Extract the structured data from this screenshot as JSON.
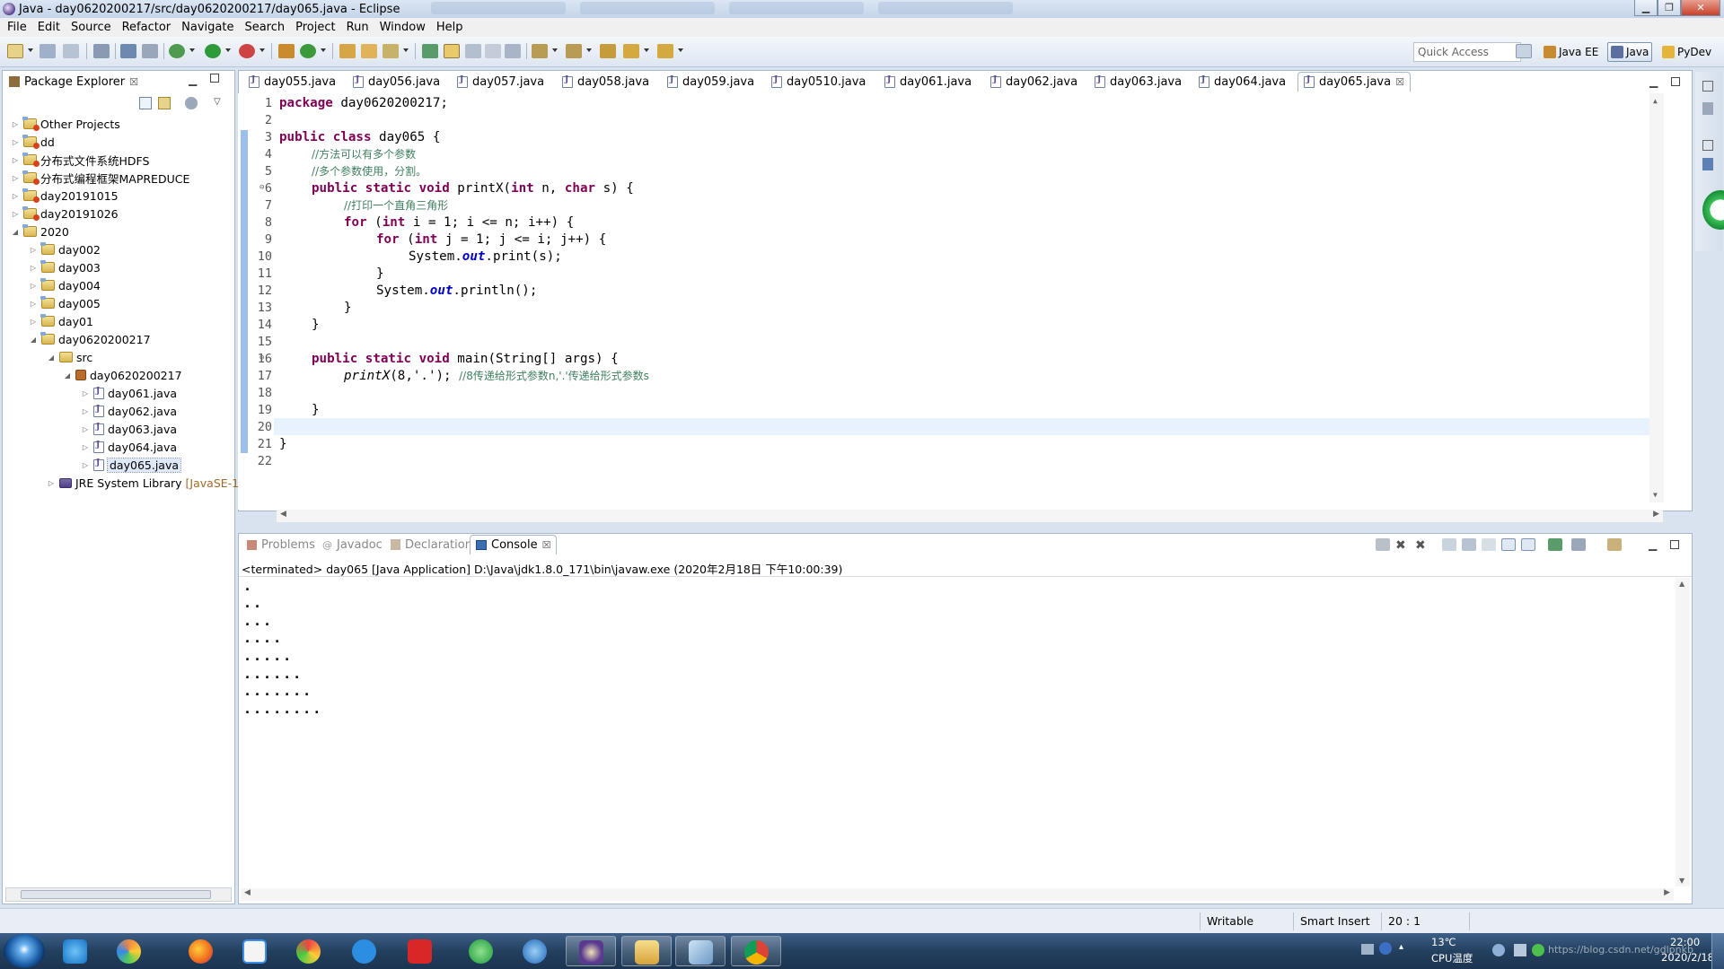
{
  "window": {
    "title": "Java - day0620200217/src/day0620200217/day065.java - Eclipse"
  },
  "menu": [
    "File",
    "Edit",
    "Source",
    "Refactor",
    "Navigate",
    "Search",
    "Project",
    "Run",
    "Window",
    "Help"
  ],
  "toolbar": {
    "quick_access": "Quick Access",
    "perspectives": [
      "Java EE",
      "Java",
      "PyDev"
    ]
  },
  "package_explorer": {
    "title": "Package Explorer",
    "tree": [
      {
        "label": "Other Projects"
      },
      {
        "label": "dd"
      },
      {
        "label": "分布式文件系统HDFS"
      },
      {
        "label": "分布式编程框架MAPREDUCE"
      },
      {
        "label": "day20191015"
      },
      {
        "label": "day20191026"
      },
      {
        "label": "2020"
      },
      {
        "label": "day002"
      },
      {
        "label": "day003"
      },
      {
        "label": "day004"
      },
      {
        "label": "day005"
      },
      {
        "label": "day01"
      },
      {
        "label": "day0620200217"
      },
      {
        "label": "src"
      },
      {
        "label": "day0620200217"
      },
      {
        "label": "day061.java"
      },
      {
        "label": "day062.java"
      },
      {
        "label": "day063.java"
      },
      {
        "label": "day064.java"
      },
      {
        "label": "day065.java"
      },
      {
        "label": "JRE System Library",
        "extra": "[JavaSE-1."
      }
    ]
  },
  "editor": {
    "tabs": [
      "day055.java",
      "day056.java",
      "day057.java",
      "day058.java",
      "day059.java",
      "day0510.java",
      "day061.java",
      "day062.java",
      "day063.java",
      "day064.java",
      "day065.java"
    ],
    "active_tab": "day065.java",
    "line_numbers": [
      "1",
      "2",
      "3",
      "4",
      "5",
      "6",
      "7",
      "8",
      "9",
      "10",
      "11",
      "12",
      "13",
      "14",
      "15",
      "16",
      "17",
      "18",
      "19",
      "20",
      "21",
      "22"
    ],
    "code": {
      "l1_kw": "package",
      "l1_rest": " day0620200217;",
      "l3_kw": "public class",
      "l3_rest": " day065 {",
      "l4": "//方法可以有多个参数",
      "l5": "//多个参数使用，分割。",
      "l6_kw": "public static void",
      "l6_a": " printX(",
      "l6_kw2": "int",
      "l6_b": " n, ",
      "l6_kw3": "char",
      "l6_c": " s) {",
      "l7": "//打印一个直角三角形",
      "l8_kw": "for",
      "l8_a": " (",
      "l8_kw2": "int",
      "l8_b": " i = 1; i <= n; i++) {",
      "l9_kw": "for",
      "l9_a": " (",
      "l9_kw2": "int",
      "l9_b": " j = 1; j <= i; j++) {",
      "l10_a": "System.",
      "l10_f": "out",
      "l10_b": ".print(s);",
      "l11": "}",
      "l12_a": "System.",
      "l12_f": "out",
      "l12_b": ".println();",
      "l13": "}",
      "l14": "}",
      "l16_kw": "public static void",
      "l16_a": " main(String[] args) {",
      "l17_a": "printX",
      "l17_b": "(8,'.'); ",
      "l17_c": "//8传递给形式参数n,'.'传递给形式参数s",
      "l19": "}",
      "l21": "}"
    }
  },
  "console": {
    "tabs": [
      "Problems",
      "Javadoc",
      "Declaration",
      "Console"
    ],
    "terminated": "<terminated> day065 [Java Application] D:\\Java\\jdk1.8.0_171\\bin\\javaw.exe (2020年2月18日 下午10:00:39)",
    "output": [
      ".",
      "..",
      "...",
      "....",
      ".....",
      "......",
      ".......",
      "........"
    ]
  },
  "status": {
    "writable": "Writable",
    "insert": "Smart Insert",
    "position": "20 : 1"
  },
  "taskbar": {
    "temp": "13℃",
    "cpu": "CPU温度",
    "time": "22:00",
    "date": "2020/2/18",
    "watermark": "https://blog.csdn.net/gdlpnkb"
  }
}
